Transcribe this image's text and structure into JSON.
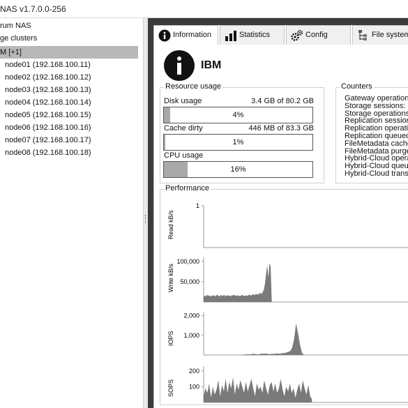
{
  "window": {
    "title": "NAS v1.7.0.0-256"
  },
  "tree": {
    "items": [
      {
        "label": "rum NAS"
      },
      {
        "label": "ge clusters"
      },
      {
        "label": "M [+1]"
      },
      {
        "label": "node01 (192.168.100.11)"
      },
      {
        "label": "node02 (192.168.100.12)"
      },
      {
        "label": "node03 (192.168.100.13)"
      },
      {
        "label": "node04 (192.168.100.14)"
      },
      {
        "label": "node05 (192.168.100.15)"
      },
      {
        "label": "node06 (192.168.100.16)"
      },
      {
        "label": "node07 (192.168.100.17)"
      },
      {
        "label": "node08 (192.168.100.18)"
      }
    ]
  },
  "tabs": [
    {
      "label": "Information",
      "icon": "info-icon"
    },
    {
      "label": "Statistics",
      "icon": "bar-chart-icon"
    },
    {
      "label": "Config",
      "icon": "gears-icon"
    },
    {
      "label": "File system",
      "icon": "folder-tree-icon"
    }
  ],
  "header": {
    "title": "IBM"
  },
  "resources": {
    "title": "Resource usage",
    "disk": {
      "label": "Disk usage",
      "value": "3.4 GB of 80.2 GB",
      "pct_text": "4%",
      "fraction": 0.04
    },
    "cache": {
      "label": "Cache dirty",
      "value": "446 MB of 83.3 GB",
      "pct_text": "1%",
      "fraction": 0.01
    },
    "cpu": {
      "label": "CPU usage",
      "pct_text": "16%",
      "fraction": 0.16
    }
  },
  "counters": {
    "title": "Counters",
    "items": [
      "Gateway operations:",
      "Storage sessions:",
      "Storage operations:",
      "Replication sessions:",
      "Replication operatio",
      "Replication queued:",
      "FileMetadata cached",
      "FileMetadata purgec",
      "Hybrid-Cloud opera",
      "Hybrid-Cloud queue",
      "Hybrid-Cloud transfe"
    ]
  },
  "performance": {
    "title": "Performance",
    "fill_color": "#7a7a7a"
  },
  "chart_data": [
    {
      "type": "area",
      "ylabel": "Read kB/s",
      "yticks": [
        "1"
      ],
      "ylim": [
        0,
        1
      ],
      "values": [
        0,
        0,
        0,
        0,
        0,
        0,
        0,
        0,
        0,
        0
      ]
    },
    {
      "type": "area",
      "ylabel": "Write kB/s",
      "yticks": [
        "100,000",
        "50,000"
      ],
      "ylim": [
        0,
        110000
      ],
      "values": [
        12000,
        16000,
        14000,
        18000,
        15000,
        17000,
        13000,
        16000,
        15000,
        17000,
        14000,
        16000,
        18000,
        15000,
        14000,
        17000,
        16000,
        15000,
        18000,
        14000,
        16000,
        17000,
        15000,
        16000,
        14000,
        17000,
        16000,
        18000,
        15000,
        16000,
        17000,
        14000,
        16000,
        15000,
        18000,
        16000,
        14000,
        17000,
        15000,
        16000,
        18000,
        17000,
        16000,
        19000,
        18000,
        17000,
        20000,
        19000,
        18000,
        21000,
        22000,
        20000,
        24000,
        30000,
        45000,
        70000,
        90000,
        60000,
        95000,
        88000,
        0,
        0,
        0,
        0,
        0,
        0,
        0,
        0,
        0,
        0,
        0,
        0,
        0,
        0,
        0,
        0,
        0,
        0,
        0,
        0,
        0,
        0,
        0,
        0,
        0,
        0,
        0,
        0,
        0,
        0,
        0,
        0,
        0,
        0,
        0,
        0,
        0,
        0,
        0,
        0
      ]
    },
    {
      "type": "area",
      "ylabel": "IOPS",
      "yticks": [
        "2,000",
        "1,000"
      ],
      "ylim": [
        0,
        2200
      ],
      "values": [
        0,
        0,
        0,
        0,
        0,
        0,
        0,
        0,
        0,
        0,
        0,
        0,
        0,
        0,
        0,
        0,
        0,
        0,
        0,
        0,
        30,
        20,
        40,
        30,
        50,
        60,
        40,
        30,
        50,
        70,
        60,
        80,
        50,
        40,
        60,
        50,
        80,
        70,
        60,
        100,
        90,
        120,
        150,
        200,
        350,
        800,
        1600,
        1100,
        500,
        100,
        0,
        0,
        0,
        0,
        0,
        0,
        0,
        0,
        0,
        0
      ]
    },
    {
      "type": "area",
      "ylabel": "SOPS",
      "yticks": [
        "200",
        "100"
      ],
      "ylim": [
        0,
        230
      ],
      "values": [
        40,
        90,
        60,
        120,
        30,
        100,
        50,
        80,
        140,
        40,
        110,
        70,
        150,
        60,
        130,
        90,
        160,
        50,
        120,
        80,
        140,
        100,
        60,
        130,
        70,
        110,
        150,
        90,
        40,
        120,
        80,
        100,
        60,
        140,
        90,
        50,
        110,
        130,
        70,
        120,
        60,
        90,
        150,
        80,
        40,
        100,
        70,
        120,
        60,
        90,
        30,
        80,
        120,
        60,
        140,
        90,
        50,
        110,
        40,
        20
      ]
    }
  ]
}
